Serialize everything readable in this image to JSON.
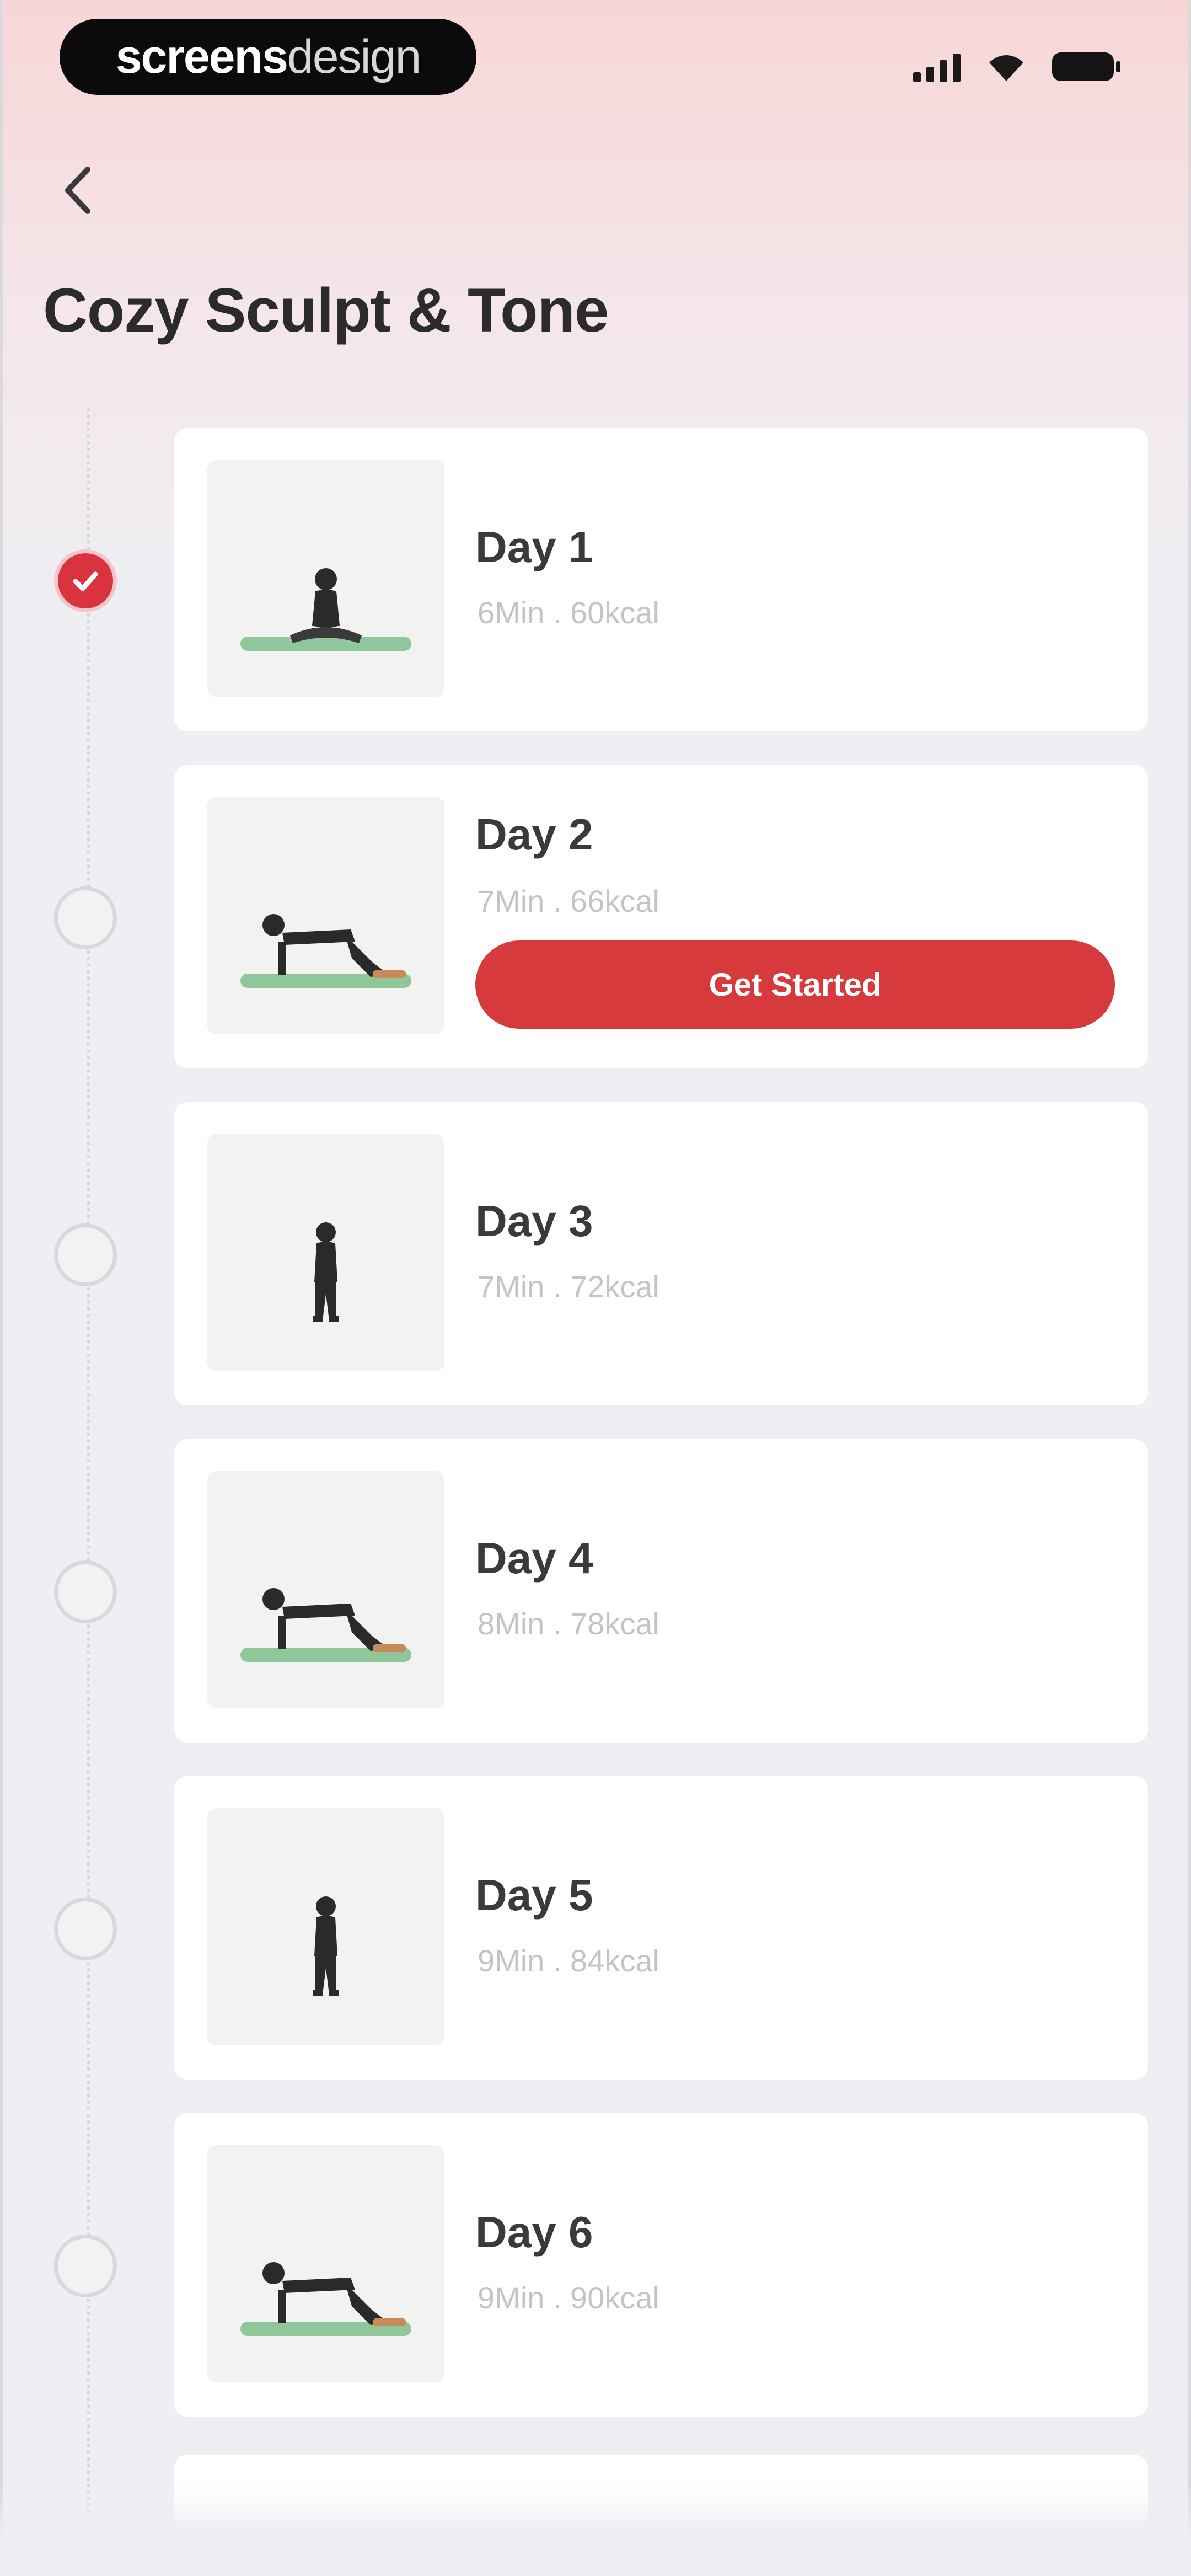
{
  "status_bar": {
    "brand_bold": "screens",
    "brand_light": "design",
    "signal_icon": "cellular-signal-icon",
    "wifi_icon": "wifi-icon",
    "battery_icon": "battery-icon"
  },
  "header": {
    "back_icon": "chevron-left-icon",
    "title": "Cozy Sculpt & Tone"
  },
  "colors": {
    "accent": "#d73a3c",
    "completed": "#d9333f",
    "title_text": "#2b2b2e",
    "meta_text": "#c4c4c8"
  },
  "days": [
    {
      "title": "Day 1",
      "meta": "6Min . 60kcal",
      "completed": true,
      "pose": "seated"
    },
    {
      "title": "Day 2",
      "meta": "7Min . 66kcal",
      "completed": false,
      "pose": "kneeling",
      "button_label": "Get Started"
    },
    {
      "title": "Day 3",
      "meta": "7Min . 72kcal",
      "completed": false,
      "pose": "standing"
    },
    {
      "title": "Day 4",
      "meta": "8Min . 78kcal",
      "completed": false,
      "pose": "kneeling"
    },
    {
      "title": "Day 5",
      "meta": "9Min . 84kcal",
      "completed": false,
      "pose": "standing"
    },
    {
      "title": "Day 6",
      "meta": "9Min . 90kcal",
      "completed": false,
      "pose": "kneeling"
    }
  ]
}
